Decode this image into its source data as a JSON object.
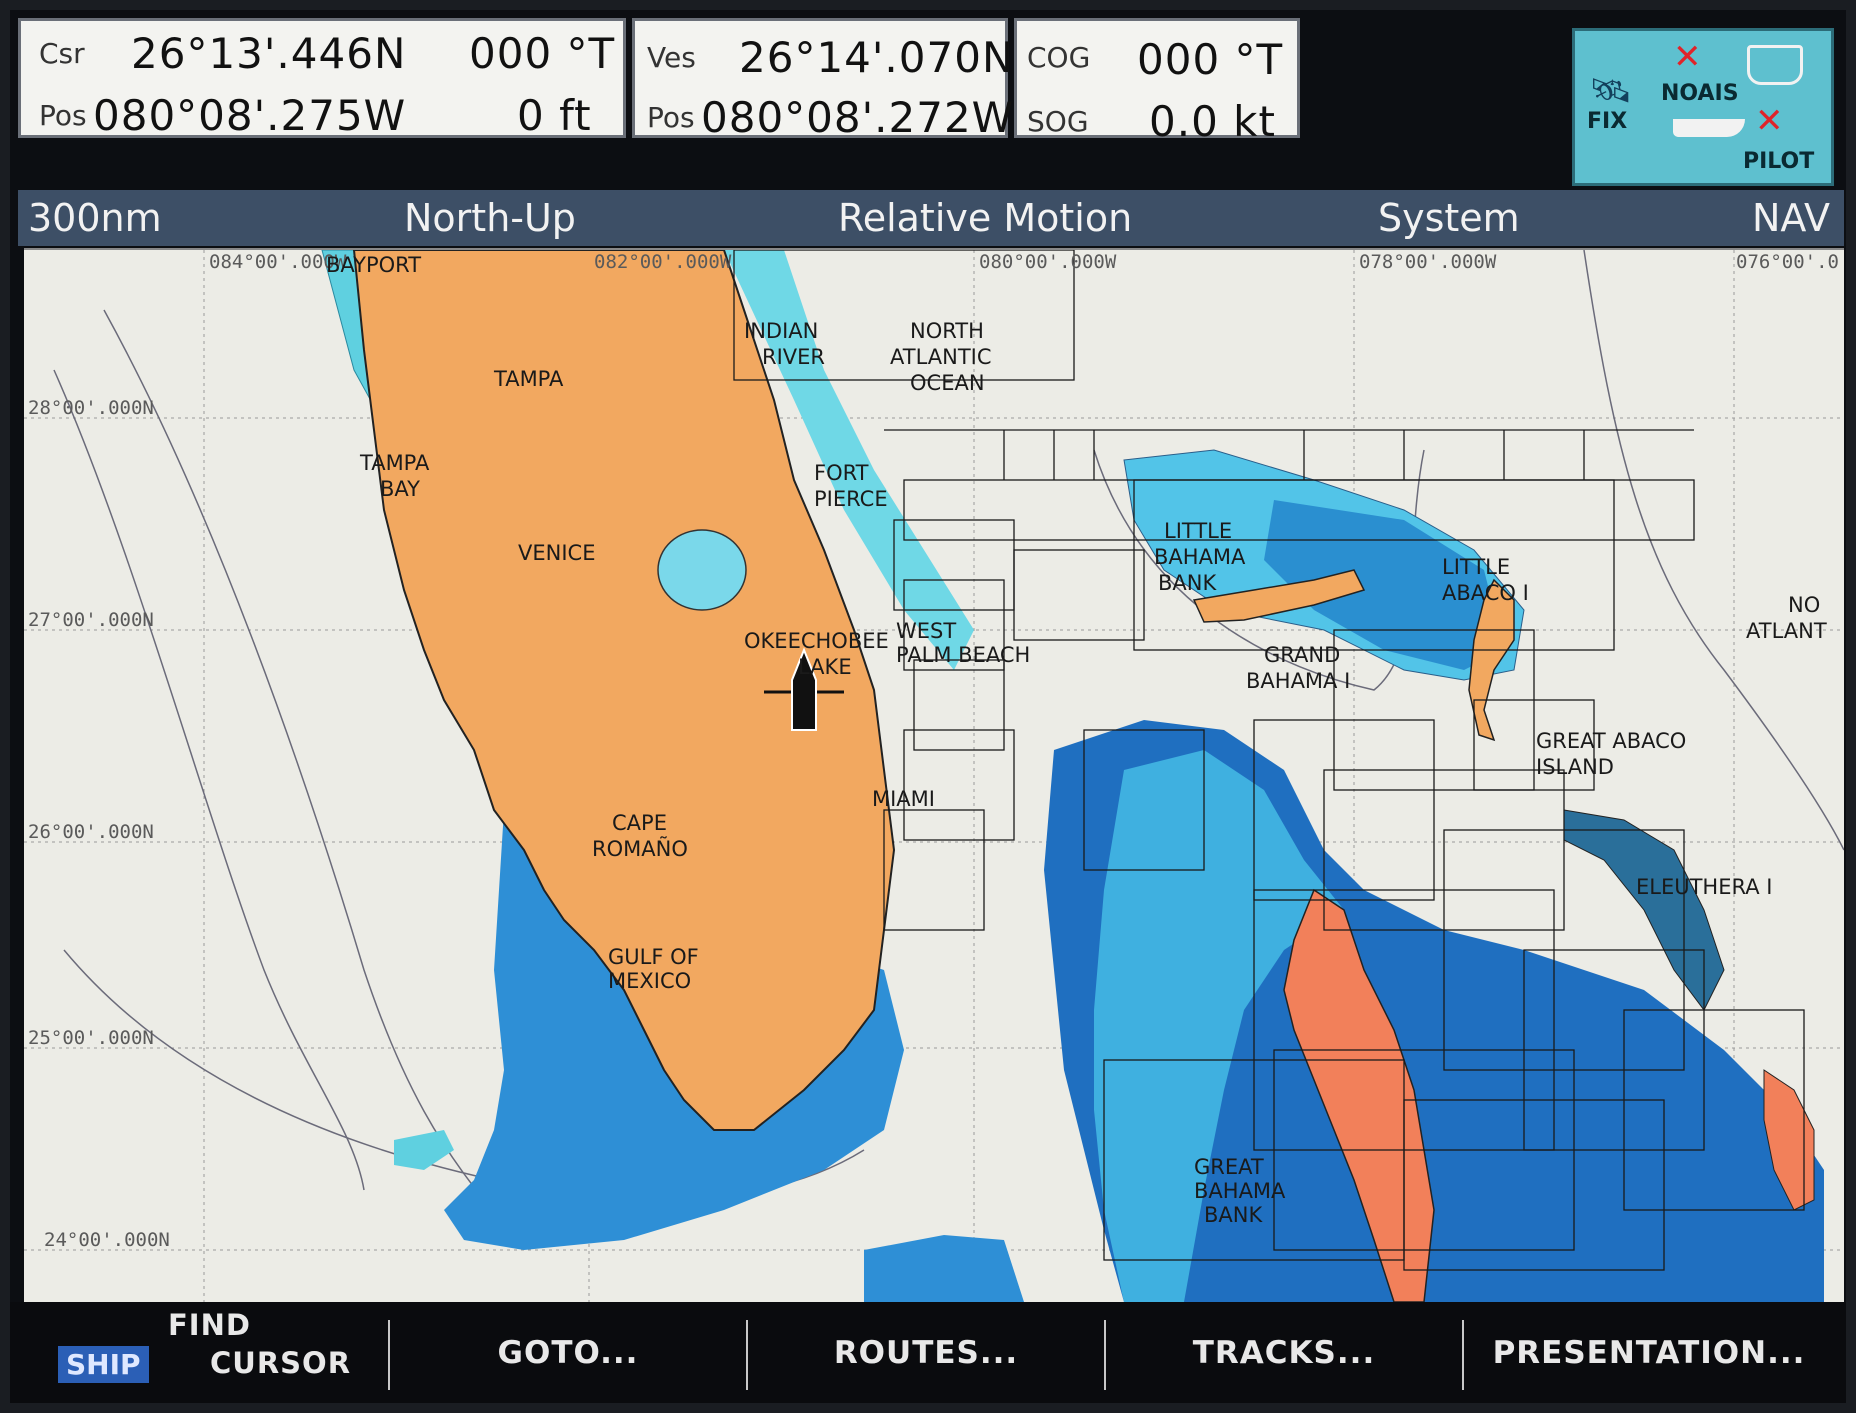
{
  "panels": {
    "cursor": {
      "csr_label": "Csr",
      "lat": "26°13'.446N",
      "heading": "000 °T",
      "pos_label": "Pos",
      "lon": "080°08'.275W",
      "depth": "0 ft"
    },
    "vessel": {
      "ves_label": "Ves",
      "lat": "26°14'.070N",
      "pos_label": "Pos",
      "lon": "080°08'.272W"
    },
    "course": {
      "cog_label": "COG",
      "cog": "000 °T",
      "sog_label": "SOG",
      "sog": "0.0 kt"
    }
  },
  "status": {
    "fix": "FIX",
    "noais": "NOAIS",
    "pilot": "PILOT"
  },
  "header": {
    "range": "300nm",
    "orientation": "North-Up",
    "motion": "Relative Motion",
    "mode": "System",
    "nav": "NAV"
  },
  "chart": {
    "grid": {
      "lon_1": "084°00'.000W",
      "lon_2": "082°00'.000W",
      "lon_3": "080°00'.000W",
      "lon_4": "078°00'.000W",
      "lon_5": "076°00'.0",
      "lat_1": "28°00'.000N",
      "lat_2": "27°00'.000N",
      "lat_3": "26°00'.000N",
      "lat_4": "25°00'.000N",
      "lat_5": "24°00'.000N"
    },
    "places": {
      "bayport": "BAYPORT",
      "tampa": "TAMPA",
      "tampa_bay_1": "TAMPA",
      "tampa_bay_2": "BAY",
      "indian_river_1": "INDIAN",
      "indian_river_2": "RIVER",
      "north_atlantic_1": "NORTH",
      "north_atlantic_2": "ATLANTIC",
      "north_atlantic_3": "OCEAN",
      "fort_pierce_1": "FORT",
      "fort_pierce_2": "PIERCE",
      "venice": "VENICE",
      "okeechobee_1": "OKEECHOBEE",
      "okeechobee_2": "LAKE",
      "west_palm_1": "WEST",
      "west_palm_2": "PALM BEACH",
      "miami": "MIAMI",
      "cape_romano_1": "CAPE",
      "cape_romano_2": "ROMAÑO",
      "gulf_1": "GULF OF",
      "gulf_2": "MEXICO",
      "little_bahama_1": "LITTLE",
      "little_bahama_2": "BAHAMA",
      "little_bahama_3": "BANK",
      "little_abaco_1": "LITTLE",
      "little_abaco_2": "ABACO I",
      "grand_bahama_1": "GRAND",
      "grand_bahama_2": "BAHAMA I",
      "great_abaco_1": "GREAT ABACO",
      "great_abaco_2": "ISLAND",
      "eleuthera": "ELEUTHERA I",
      "great_bahama_bank_1": "GREAT",
      "great_bahama_bank_2": "BAHAMA",
      "great_bahama_bank_3": "BANK",
      "north_atlantic_edge_1": "NO",
      "north_atlantic_edge_2": "ATLANT"
    }
  },
  "softkeys": {
    "find": "FIND",
    "ship": "SHIP",
    "cursor": "CURSOR",
    "goto": "GOTO...",
    "routes": "ROUTES...",
    "tracks": "TRACKS...",
    "presentation": "PRESENTATION..."
  }
}
